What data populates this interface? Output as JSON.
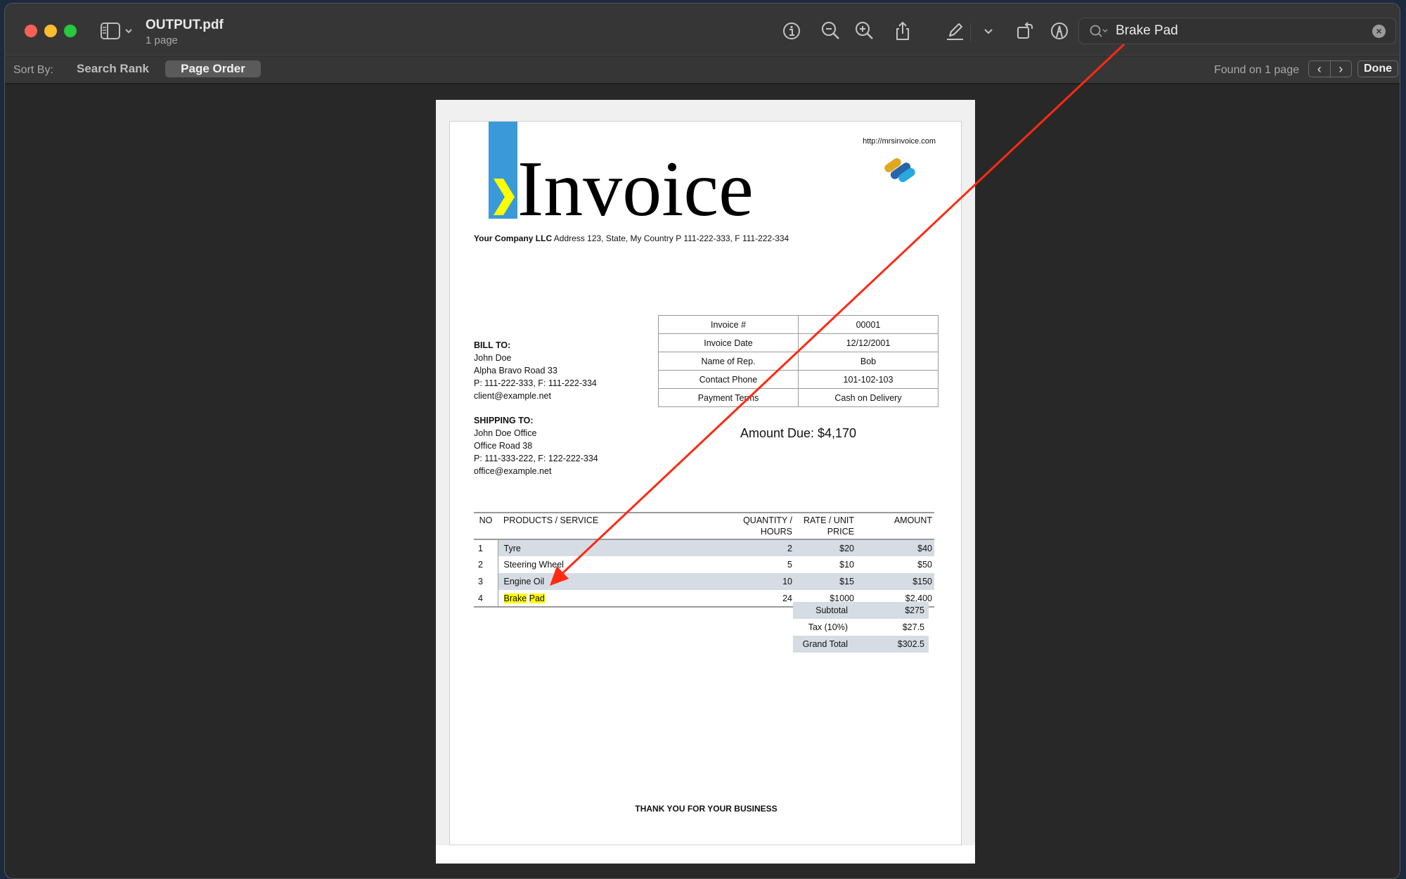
{
  "window": {
    "title": "OUTPUT.pdf",
    "subtitle": "1 page"
  },
  "toolbar": {
    "icons": [
      "info-icon",
      "zoom-out-icon",
      "zoom-in-icon",
      "share-icon",
      "highlight-pen-icon",
      "chevron-down-icon",
      "rotate-icon",
      "markup-icon"
    ]
  },
  "search": {
    "value": "Brake Pad",
    "clear_label": "×"
  },
  "sort_bar": {
    "label": "Sort By:",
    "options": [
      "Search Rank",
      "Page Order"
    ],
    "selected": "Page Order",
    "found_text": "Found on 1 page",
    "prev_label": "‹",
    "next_label": "›",
    "done_label": "Done"
  },
  "invoice": {
    "title": "Invoice",
    "url": "http://mrsinvoice.com",
    "company_name": "Your Company LLC",
    "company_details": " Address 123, State, My Country P 111-222-333, F 111-222-334",
    "bill_to": {
      "heading": "BILL TO:",
      "lines": [
        "John Doe",
        "Alpha Bravo Road 33",
        "P: 111-222-333, F: 111-222-334",
        "client@example.net"
      ]
    },
    "ship_to": {
      "heading": "SHIPPING TO:",
      "lines": [
        "John Doe Office",
        "Office Road 38",
        "P: 111-333-222, F: 122-222-334",
        "office@example.net"
      ]
    },
    "meta": [
      {
        "label": "Invoice #",
        "value": "00001"
      },
      {
        "label": "Invoice Date",
        "value": "12/12/2001"
      },
      {
        "label": "Name of Rep.",
        "value": "Bob"
      },
      {
        "label": "Contact Phone",
        "value": "101-102-103"
      },
      {
        "label": "Payment Terms",
        "value": "Cash on Delivery"
      }
    ],
    "amount_due": "Amount Due: $4,170",
    "items_header": {
      "no": "NO",
      "product": "PRODUCTS / SERVICE",
      "qty_line1": "QUANTITY /",
      "qty_line2": "HOURS",
      "rate_line1": "RATE / UNIT",
      "rate_line2": "PRICE",
      "amount": "AMOUNT"
    },
    "items": [
      {
        "no": "1",
        "product": "Tyre",
        "qty": "2",
        "rate": "$20",
        "amount": "$40"
      },
      {
        "no": "2",
        "product": "Steering Wheel",
        "qty": "5",
        "rate": "$10",
        "amount": "$50"
      },
      {
        "no": "3",
        "product": "Engine Oil",
        "qty": "10",
        "rate": "$15",
        "amount": "$150"
      },
      {
        "no": "4",
        "product_word1": "Brake",
        "product_word2": "Pad",
        "qty": "24",
        "rate": "$1000",
        "amount": "$2,400"
      }
    ],
    "totals": [
      {
        "label": "Subtotal",
        "value": "$275"
      },
      {
        "label": "Tax (10%)",
        "value": "$27.5"
      },
      {
        "label": "Grand Total",
        "value": "$302.5"
      }
    ],
    "footer": "THANK YOU FOR YOUR BUSINESS"
  },
  "colors": {
    "search_highlight": "#ffff00",
    "annotation_arrow": "#ff2a12",
    "brand_blue": "#3a9ad9",
    "row_shade": "#d6dce4"
  }
}
